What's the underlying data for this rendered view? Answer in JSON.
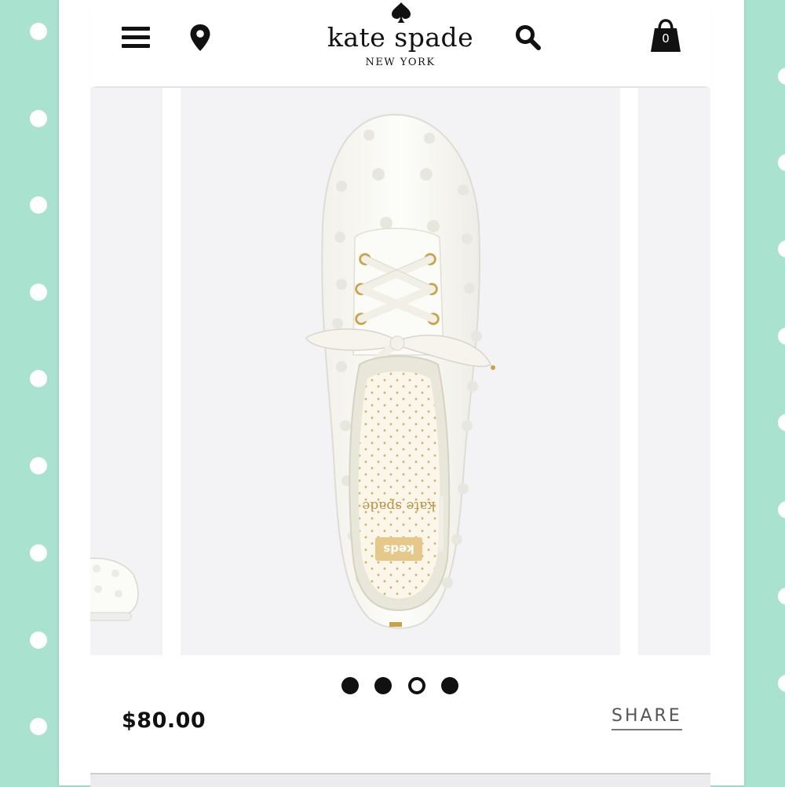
{
  "header": {
    "brand_name": "kate spade",
    "brand_city": "NEW YORK",
    "cart_count": "0"
  },
  "product": {
    "price": "$80.00",
    "share_label": "SHARE",
    "insole_text": "kate spade",
    "label_text": "keds"
  },
  "carousel": {
    "total_slides": 4,
    "active_index": 2
  },
  "colors": {
    "background_mint": "#a9e2cf",
    "text_dark": "#111111"
  },
  "icons": [
    "menu-icon",
    "location-pin-icon",
    "spade-logo-icon",
    "search-icon",
    "shopping-bag-icon"
  ]
}
